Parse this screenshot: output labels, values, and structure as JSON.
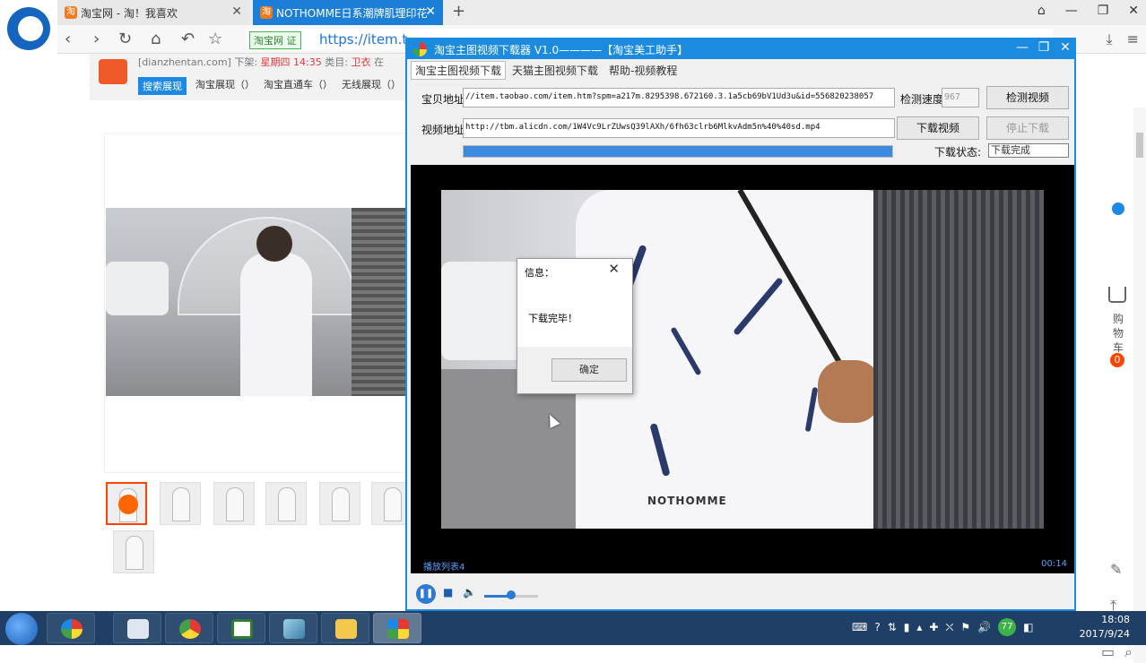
{
  "browser": {
    "tabs": [
      {
        "label": "淘宝网 - 淘！我喜欢",
        "favicon": "淘"
      },
      {
        "label": "NOTHOMME日系潮牌肌理印花",
        "favicon": "淘"
      }
    ],
    "url": "https://item.t",
    "verify_label": "淘宝网 证"
  },
  "page": {
    "shop_line": "[dianzhentan.com] 下架:",
    "shop_weekday": "星期四 14:35",
    "category_label": "类目:",
    "category_value": "卫衣",
    "more": "在",
    "search_tabs": [
      "搜索展现",
      "淘宝展现（）",
      "淘宝直通车（）",
      "无线展现（）"
    ],
    "cart_label": "购物车",
    "cart_count": "0"
  },
  "downloader": {
    "title": "淘宝主图视频下载器 V1.0————【淘宝美工助手】",
    "menu": [
      "淘宝主图视频下载",
      "天猫主图视频下载",
      "帮助-视频教程"
    ],
    "item_url_label": "宝贝地址",
    "item_url_value": "//item.taobao.com/item.htm?spm=a217m.8295398.672160.3.1a5cb69bV1Ud3u&id=556820238057",
    "speed_label": "检测速度",
    "speed_value": "967",
    "detect_button": "检测视频",
    "video_url_label": "视频地址",
    "video_url_value": "http://tbm.alicdn.com/1W4Vc9LrZUwsQ39lAXh/6fh63clrb6MlkvAdm5n%40%40sd.mp4",
    "download_button": "下载视频",
    "stop_button": "停止下载",
    "progress": 1.0,
    "status_label": "下载状态:",
    "status_value": "下载完成",
    "player_brand": "NOTHOMME",
    "playlist_label": "播放列表4",
    "time": "00:14",
    "volume": 0.5
  },
  "dialog": {
    "title": "信息：",
    "message": "下载完毕！",
    "ok": "确定"
  },
  "taskbar": {
    "battery": "77",
    "time": "18:08",
    "date": "2017/9/24"
  },
  "colors": {
    "accent": "#1b8be0",
    "taobao_orange": "#f05a28",
    "taskbar": "#1f3f66"
  }
}
